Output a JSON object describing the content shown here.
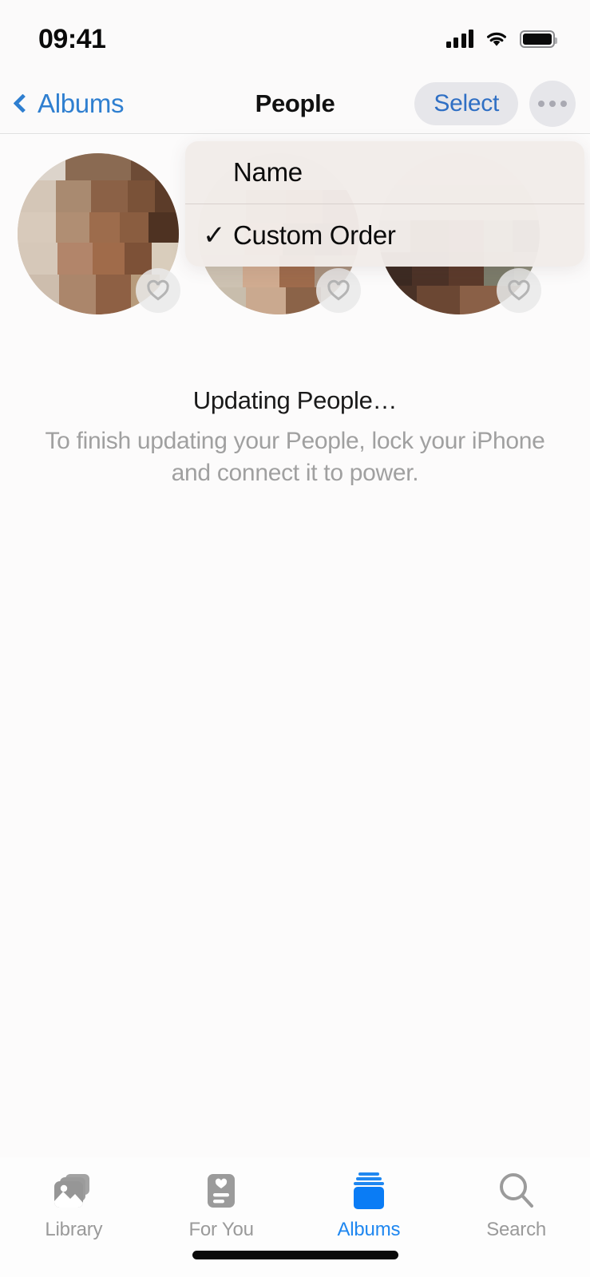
{
  "status_bar": {
    "time": "09:41",
    "cellular_icon": "cellular-signal-icon",
    "wifi_icon": "wifi-icon",
    "battery_icon": "battery-full-icon"
  },
  "nav_bar": {
    "back_label": "Albums",
    "back_icon": "chevron-left-icon",
    "title": "People",
    "select_label": "Select",
    "more_icon": "ellipsis-icon"
  },
  "context_menu": {
    "items": [
      {
        "label": "Name",
        "checked": false
      },
      {
        "label": "Custom Order",
        "checked": true,
        "check_glyph": "✓"
      }
    ]
  },
  "people": [
    {
      "badge_icon": "heart-icon",
      "favorite": true
    },
    {
      "badge_icon": "heart-icon",
      "favorite": true
    },
    {
      "badge_icon": "heart-icon",
      "favorite": true
    }
  ],
  "status_message": {
    "title": "Updating People…",
    "subtitle": "To finish updating your People, lock your iPhone and connect it to power."
  },
  "tab_bar": {
    "tabs": [
      {
        "label": "Library",
        "icon": "photo-stack-icon",
        "active": false
      },
      {
        "label": "For You",
        "icon": "memories-card-icon",
        "active": false
      },
      {
        "label": "Albums",
        "icon": "albums-icon",
        "active": true
      },
      {
        "label": "Search",
        "icon": "magnifier-icon",
        "active": false
      }
    ]
  },
  "colors": {
    "accent_blue": "#1f87f0",
    "link_blue": "#2f7fd0",
    "menu_bg": "#f2ece9",
    "tab_inactive": "#9a9a9a",
    "subtitle_gray": "#a0a0a0"
  }
}
